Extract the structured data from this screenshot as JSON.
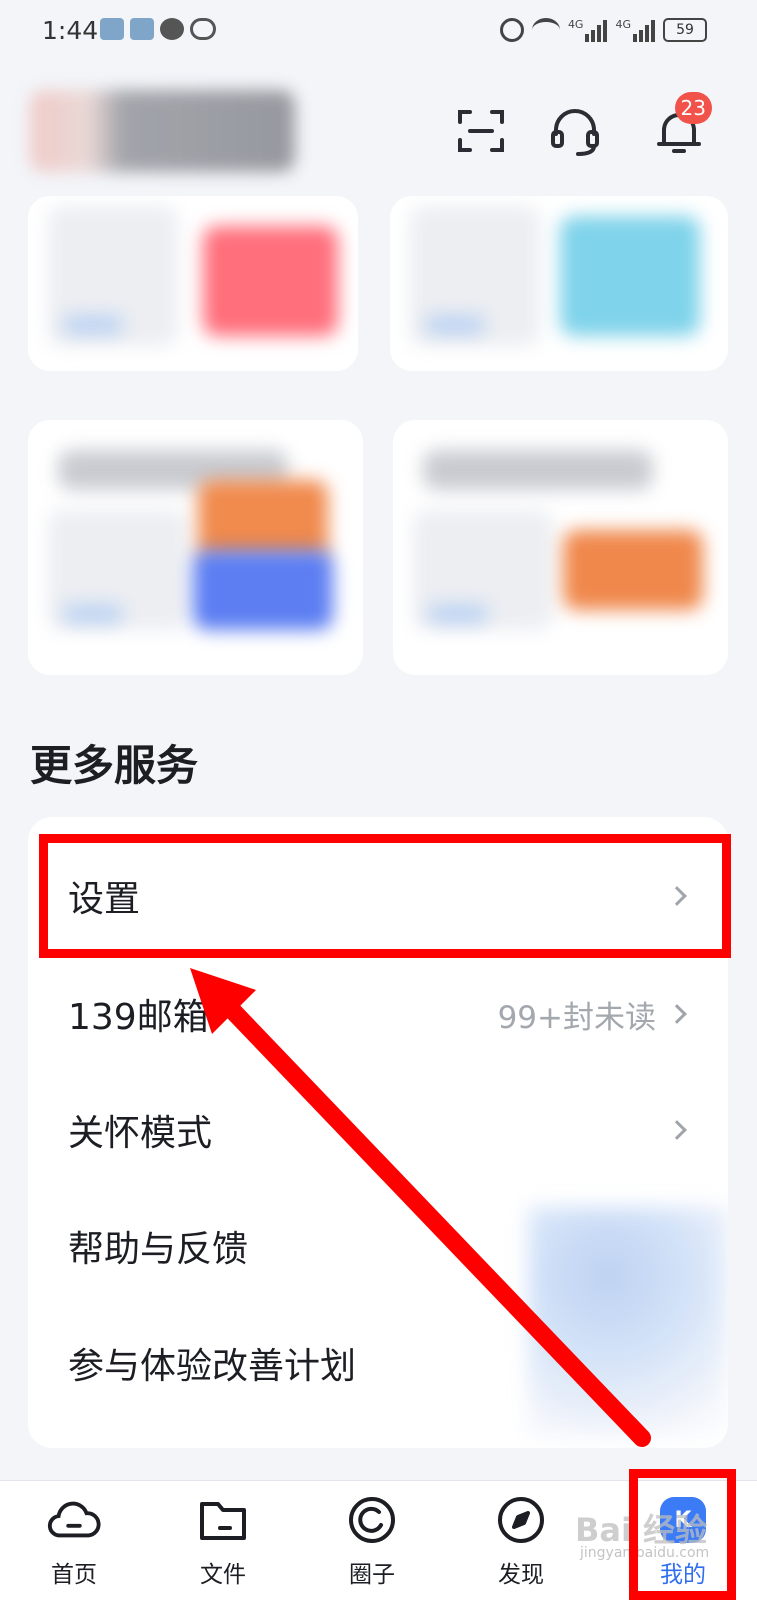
{
  "status_bar": {
    "time": "1:44",
    "battery": "59",
    "network_1": "4G",
    "network_2": "4G"
  },
  "header": {
    "notification_count": "23",
    "scan_icon": "scan-icon",
    "support_icon": "headset-icon",
    "bell_icon": "bell-icon"
  },
  "more_services": {
    "title": "更多服务",
    "items": [
      {
        "label": "设置",
        "sub": ""
      },
      {
        "label": "139邮箱",
        "sub": "99+封未读"
      },
      {
        "label": "关怀模式",
        "sub": ""
      },
      {
        "label": "帮助与反馈",
        "sub": ""
      },
      {
        "label": "参与体验改善计划",
        "sub": ""
      }
    ]
  },
  "bottom_nav": {
    "items": [
      {
        "label": "首页",
        "icon": "cloud-icon"
      },
      {
        "label": "文件",
        "icon": "folder-icon"
      },
      {
        "label": "圈子",
        "icon": "circle-icon"
      },
      {
        "label": "发现",
        "icon": "compass-icon"
      },
      {
        "label": "我的",
        "icon": "me-icon",
        "active": true
      }
    ],
    "active_color": "#2f6ff0"
  },
  "watermark": {
    "text": "Bai 经验",
    "sub": "jingyan.baidu.com"
  },
  "annotation_color": "#ff0000"
}
